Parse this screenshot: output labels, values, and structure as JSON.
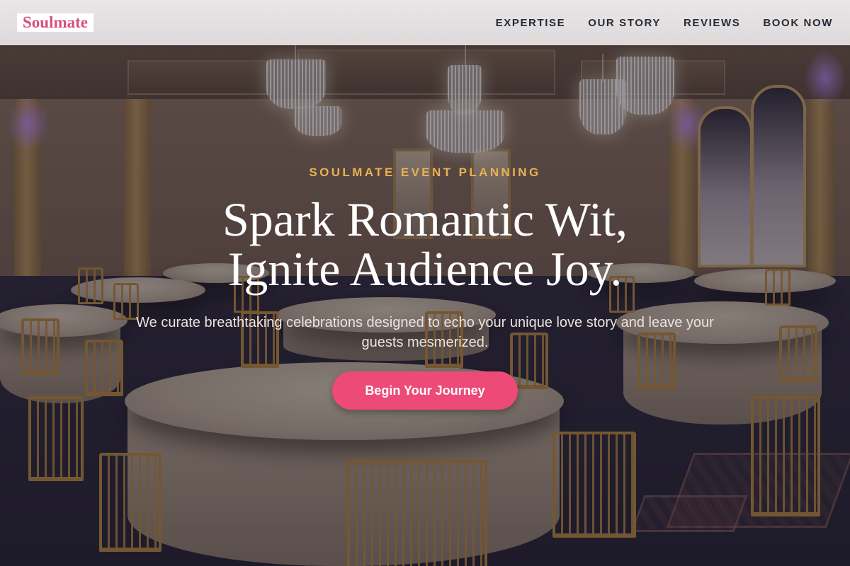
{
  "header": {
    "logo": "Soulmate",
    "nav": [
      {
        "label": "EXPERTISE"
      },
      {
        "label": "OUR STORY"
      },
      {
        "label": "REVIEWS"
      },
      {
        "label": "BOOK NOW"
      }
    ]
  },
  "hero": {
    "eyebrow": "SOULMATE EVENT PLANNING",
    "headline_line1": "Spark Romantic Wit,",
    "headline_line2": "Ignite Audience Joy.",
    "subtext": "We curate breathtaking celebrations designed to echo your unique love story and leave your guests mesmerized.",
    "cta_label": "Begin Your Journey"
  },
  "colors": {
    "brand_pink": "#ed4a77",
    "logo_pink": "#d94f7d",
    "eyebrow_gold": "#e8b354",
    "nav_text": "#262a35",
    "header_bg": "#e6e3e4"
  }
}
